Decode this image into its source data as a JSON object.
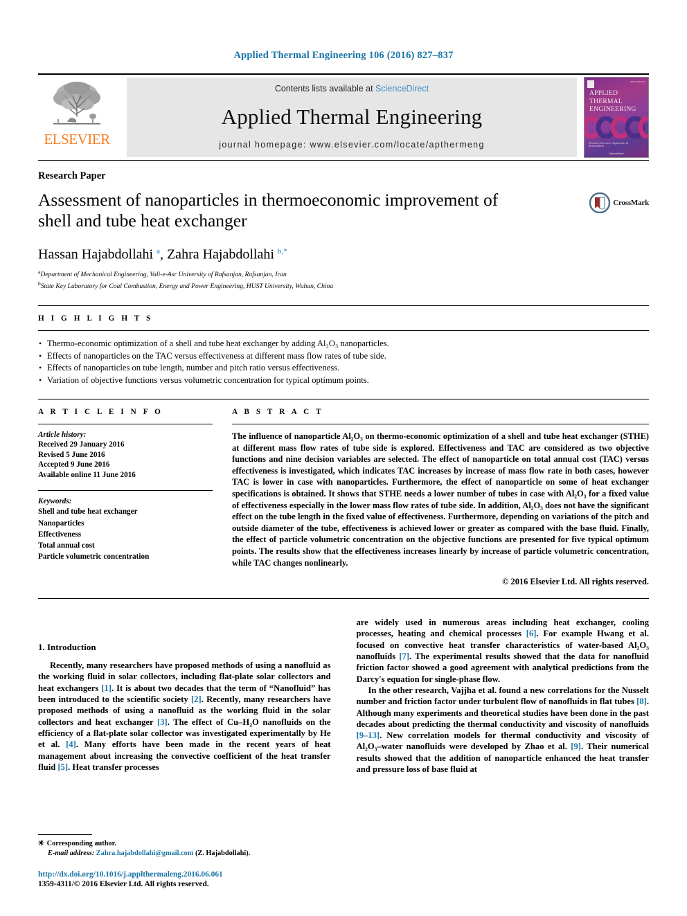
{
  "running_head": "Applied Thermal Engineering 106 (2016) 827–837",
  "masthead": {
    "elsevier_wordmark": "ELSEVIER",
    "contents_prefix": "Contents lists available at ",
    "sciencedirect": "ScienceDirect",
    "journal_title": "Applied Thermal Engineering",
    "homepage": "journal homepage: www.elsevier.com/locate/apthermeng",
    "cover": {
      "line1": "APPLIED",
      "line2": "THERMAL",
      "line3": "ENGINEERING",
      "footer": "Thermal Processes, Equipment & Environment",
      "publisher": "ScienceDirect",
      "issn": "ISSN 1359-4311"
    }
  },
  "article": {
    "type": "Research Paper",
    "title": "Assessment of nanoparticles in thermoeconomic improvement of shell and tube heat exchanger",
    "crossmark_label": "CrossMark",
    "authors_html": "Hassan Hajabdollahi <sup>a</sup>, Zahra Hajabdollahi <sup>b,*</sup>",
    "affiliations": [
      {
        "marker": "a",
        "text": "Department of Mechanical Engineering, Vali-e-Asr University of Rafsanjan, Rafsanjan, Iran"
      },
      {
        "marker": "b",
        "text": "State Key Laboratory for Coal Combustion, Energy and Power Engineering, HUST University, Wuhan, China"
      }
    ]
  },
  "highlights": {
    "heading": "H I G H L I G H T S",
    "items": [
      "Thermo-economic optimization of a shell and tube heat exchanger by adding Al₂O₃ nanoparticles.",
      "Effects of nanoparticles on the TAC versus effectiveness at different mass flow rates of tube side.",
      "Effects of nanoparticles on tube length, number and pitch ratio versus effectiveness.",
      "Variation of objective functions versus volumetric concentration for typical optimum points."
    ]
  },
  "article_info": {
    "heading": "A R T I C L E    I N F O",
    "history_label": "Article history:",
    "history": [
      "Received 29 January 2016",
      "Revised 5 June 2016",
      "Accepted 9 June 2016",
      "Available online 11 June 2016"
    ],
    "keywords_label": "Keywords:",
    "keywords": [
      "Shell and tube heat exchanger",
      "Nanoparticles",
      "Effectiveness",
      "Total annual cost",
      "Particle volumetric concentration"
    ]
  },
  "abstract": {
    "heading": "A B S T R A C T",
    "text": "The influence of nanoparticle Al₂O₃ on thermo-economic optimization of a shell and tube heat exchanger (STHE) at different mass flow rates of tube side is explored. Effectiveness and TAC are considered as two objective functions and nine decision variables are selected. The effect of nanoparticle on total annual cost (TAC) versus effectiveness is investigated, which indicates TAC increases by increase of mass flow rate in both cases, however TAC is lower in case with nanoparticles. Furthermore, the effect of nanoparticle on some of heat exchanger specifications is obtained. It shows that STHE needs a lower number of tubes in case with Al₂O₃ for a fixed value of effectiveness especially in the lower mass flow rates of tube side. In addition, Al₂O₃ does not have the significant effect on the tube length in the fixed value of effectiveness. Furthermore, depending on variations of the pitch and outside diameter of the tube, effectiveness is achieved lower or greater as compared with the base fluid. Finally, the effect of particle volumetric concentration on the objective functions are presented for five typical optimum points. The results show that the effectiveness increases linearly by increase of particle volumetric concentration, while TAC changes nonlinearly.",
    "copyright": "© 2016 Elsevier Ltd. All rights reserved."
  },
  "introduction": {
    "heading": "1. Introduction",
    "left_paragraph_html": "Recently, many researchers have proposed methods of using a nanofluid as the working fluid in solar collectors, including flat-plate solar collectors and heat exchangers <span class=\"ref\">[1]</span>. It is about two decades that the term of “Nanofluid” has been introduced to the scientific society <span class=\"ref\">[2]</span>. Recently, many researchers have proposed methods of using a nanofluid as the working fluid in the solar collectors and heat exchanger <span class=\"ref\">[3]</span>. The effect of Cu–H₂O nanofluids on the efficiency of a flat-plate solar collector was investigated experimentally by He et al. <span class=\"ref\">[4]</span>. Many efforts have been made in the recent years of heat management about increasing the convective coefficient of the heat transfer fluid <span class=\"ref\">[5]</span>. Heat transfer processes",
    "right_paragraph_1_html": "are widely used in numerous areas including heat exchanger, cooling processes, heating and chemical processes <span class=\"ref\">[6]</span>. For example Hwang et al. focused on convective heat transfer characteristics of water-based Al₂O₃ nanofluids <span class=\"ref\">[7]</span>. The experimental results showed that the data for nanofluid friction factor showed a good agreement with analytical predictions from the Darcy's equation for single-phase flow.",
    "right_paragraph_2_html": "In the other research, Vajjha et al. found a new correlations for the Nusselt number and friction factor under turbulent flow of nanofluids in flat tubes <span class=\"ref\">[8]</span>. Although many experiments and theoretical studies have been done in the past decades about predicting the thermal conductivity and viscosity of nanofluids <span class=\"ref\">[9–13]</span>. New correlation models for thermal conductivity and viscosity of Al₂O₃–water nanofluids were developed by Zhao et al. <span class=\"ref\">[9]</span>. Their numerical results showed that the addition of nanoparticle enhanced the heat transfer and pressure loss of base fluid at"
  },
  "footnotes": {
    "corresponding_marker": "✳",
    "corresponding_text": "Corresponding author.",
    "email_label": "E-mail address:",
    "email": "Zahra.hajabdollahi@gmail.com",
    "email_suffix": "(Z. Hajabdollahi).",
    "doi": "http://dx.doi.org/10.1016/j.applthermaleng.2016.06.061",
    "issn_copyright": "1359-4311/© 2016 Elsevier Ltd. All rights reserved."
  },
  "colors": {
    "link": "#1a74a8",
    "sciencedirect": "#3b8bc6",
    "elsevier_orange": "#f58025",
    "banner_grey": "#e6e6e6"
  }
}
